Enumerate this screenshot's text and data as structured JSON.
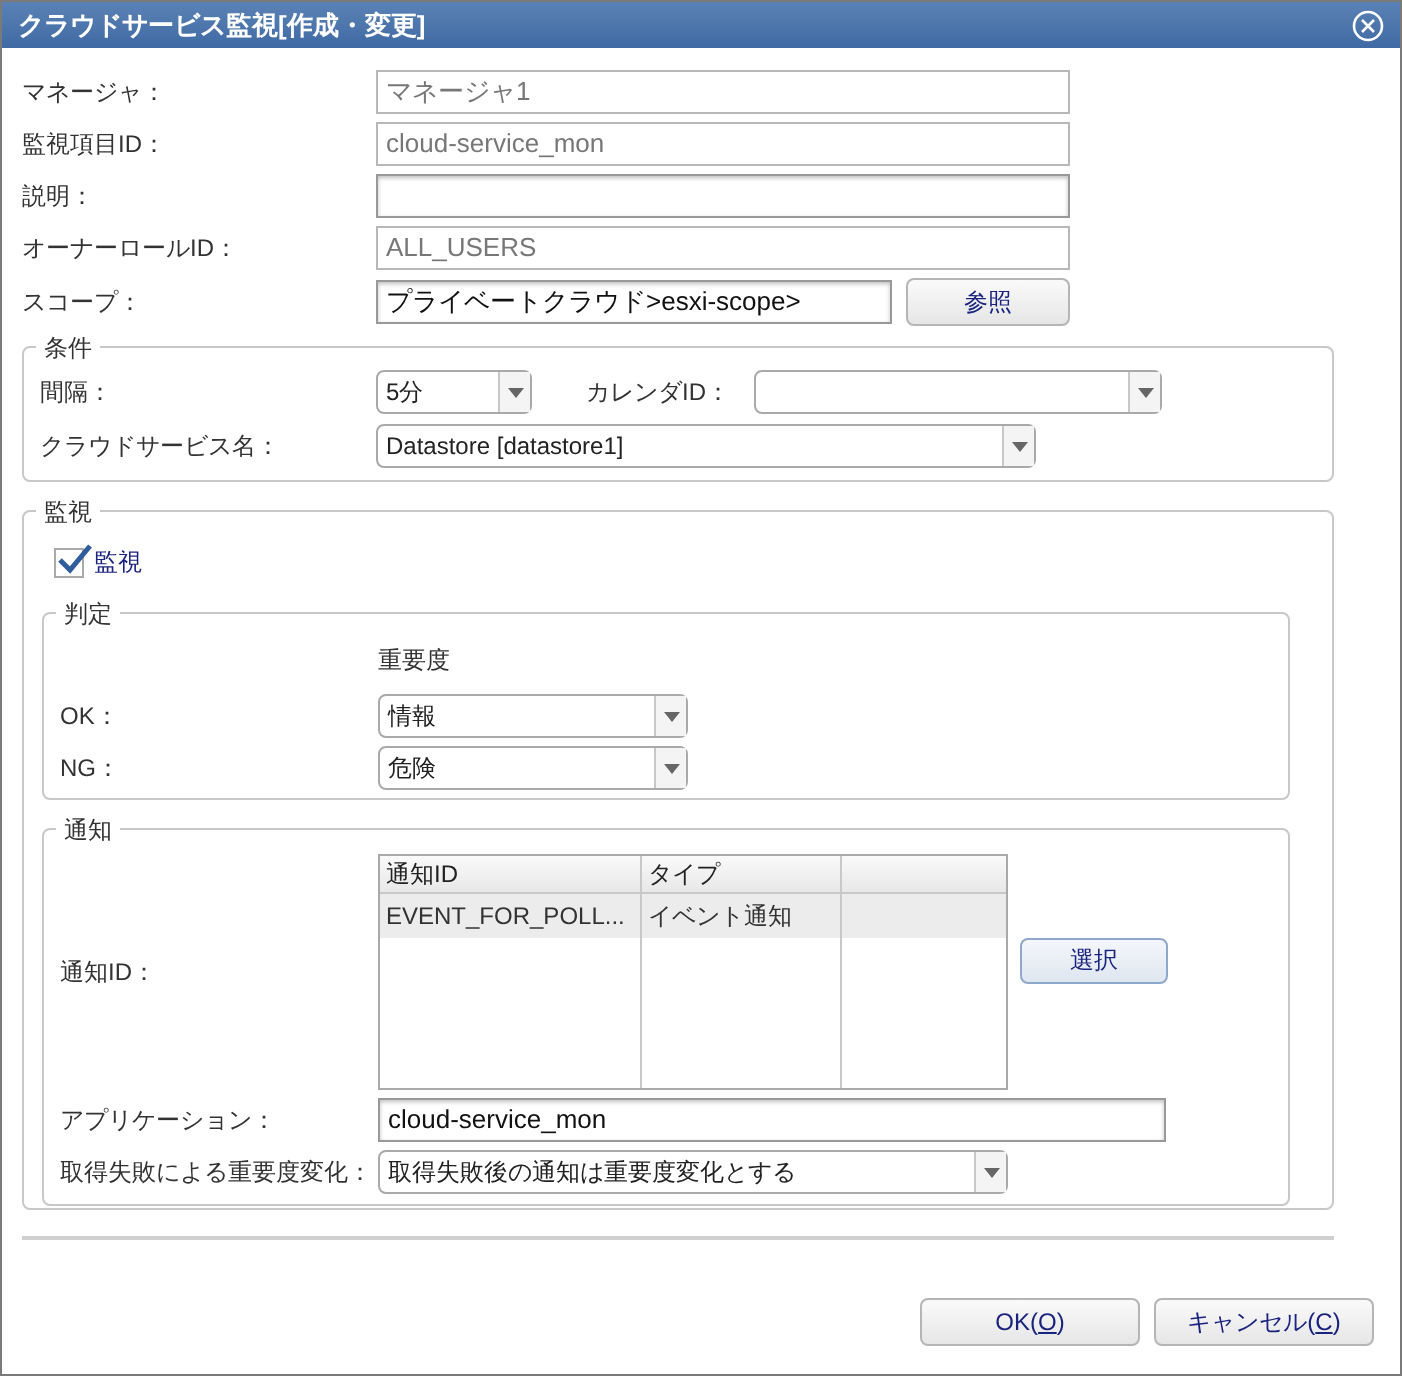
{
  "window": {
    "title": "クラウドサービス監視[作成・変更]"
  },
  "fields": [
    {
      "label": "マネージャ：",
      "value": "マネージャ1",
      "disabled": true
    },
    {
      "label": "監視項目ID：",
      "value": "cloud-service_mon",
      "disabled": true
    },
    {
      "label": "説明：",
      "disabled": false
    },
    {
      "label": "オーナーロールID：",
      "value": "ALL_USERS",
      "disabled": true
    }
  ],
  "scope": {
    "label": "スコープ：",
    "value": "プライベートクラウド>esxi-scope>",
    "button": "参照"
  },
  "conditions": {
    "title": "条件",
    "interval": {
      "label": "間隔：",
      "value": "5分"
    },
    "calendar": {
      "label": "カレンダID："
    },
    "service": {
      "label": "クラウドサービス名：",
      "value": "Datastore [datastore1]"
    }
  },
  "monitor": {
    "title": "監視",
    "checkbox": {
      "label": "監視",
      "checked": true
    },
    "judgement": {
      "title": "判定",
      "column": "重要度",
      "rows": [
        {
          "label": "OK：",
          "value": "情報"
        },
        {
          "label": "NG：",
          "value": "危険"
        }
      ]
    },
    "notification": {
      "title": "通知",
      "id_label": "通知ID：",
      "table": {
        "columns": [
          "通知ID",
          "タイプ"
        ],
        "rows": [
          {
            "cells": [
              "EVENT_FOR_POLL...",
              "イベント通知"
            ],
            "selected": true
          }
        ]
      },
      "select_button": "選択",
      "application": {
        "label": "アプリケーション：",
        "value": "cloud-service_mon"
      },
      "failure": {
        "label": "取得失敗による重要度変化：",
        "value": "取得失敗後の通知は重要度変化とする"
      }
    }
  },
  "buttons": [
    {
      "text": "OK(",
      "key": "O",
      "tail": ")"
    },
    {
      "text": "キャンセル(",
      "key": "C",
      "tail": ")"
    }
  ]
}
